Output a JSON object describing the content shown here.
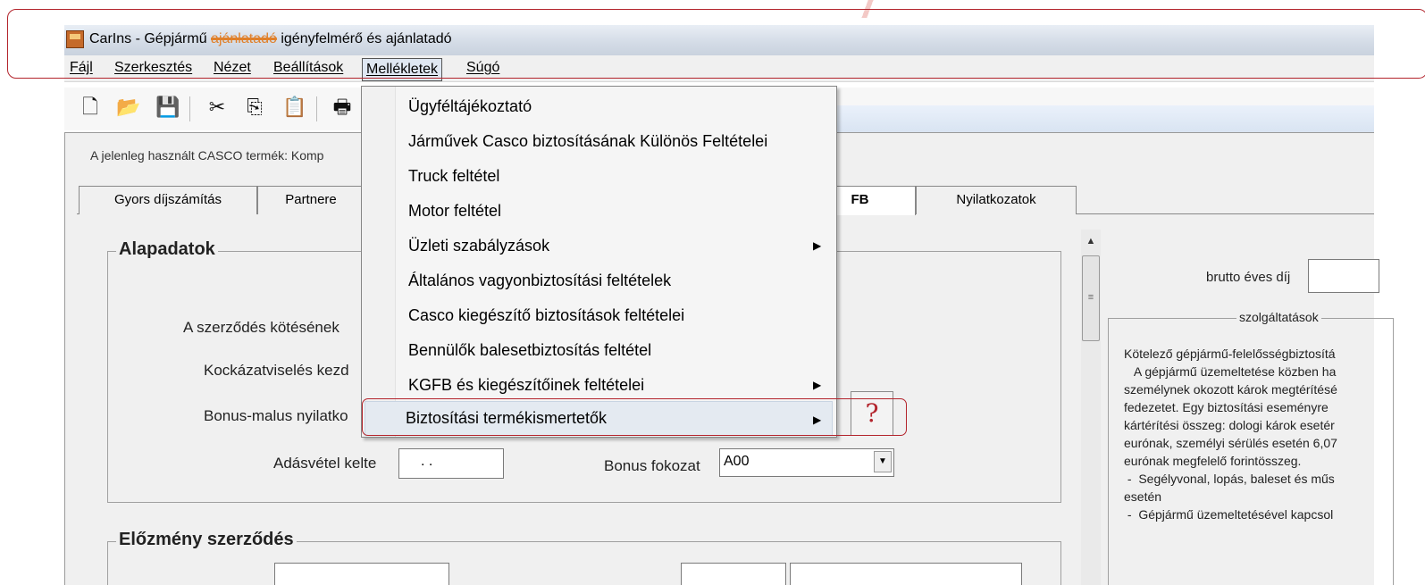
{
  "window": {
    "title_prefix": "CarIns - Gépjármű ",
    "title_struck": "ajánlatadó",
    "title_suffix": " igényfelmérő és ajánlatadó"
  },
  "menubar": {
    "items": [
      "Fájl",
      "Szerkesztés",
      "Nézet",
      "Beállítások",
      "Mellékletek",
      "Súgó"
    ],
    "active": "Mellékletek"
  },
  "toolbar": {
    "icons": [
      "new-document-icon",
      "open-folder-icon",
      "save-icon",
      "cut-icon",
      "copy-icon",
      "paste-icon",
      "print-icon"
    ],
    "glyphs": [
      "🗋",
      "📂",
      "💾",
      "✂",
      "⎘",
      "📋",
      "🖶"
    ]
  },
  "casco_text": "A jelenleg használt CASCO termék: Komp",
  "tabs": [
    {
      "label": "Gyors díjszámítás"
    },
    {
      "label": "Partnere"
    },
    {
      "label": "FB"
    },
    {
      "label": "Nyilatkozatok"
    }
  ],
  "alapadatok": {
    "title": "Alapadatok",
    "szerzodes_label": "A szerződés kötésének",
    "kockazat_label": "Kockázatviselés kezd",
    "bonus_label": "Bonus-malus nyilatko",
    "adasvetel_label": "Adásvétel kelte",
    "adasvetel_value": ". .",
    "bonus_fokozat_label": "Bonus fokozat",
    "bonus_fokozat_value": "A00"
  },
  "elozmeny": {
    "title": "Előzmény szerződés"
  },
  "right_panel": {
    "brutto_label": "brutto éves díj",
    "szolg_title": "szolgáltatások",
    "szolg_text": "Kötelező gépjármű-felelősségbiztosítá\n   A gépjármű üzemeltetése közben ha\nszemélynek okozott károk megtérítésé\nfedezetet. Egy biztosítási eseményre \nkártérítési összeg: dologi károk esetér\neurónak, személyi sérülés esetén 6,07\neurónak megfelelő forintösszeg.\n -  Segélyvonal, lopás, baleset és műs\nesetén\n -  Gépjármű üzemeltetésével kapcsol"
  },
  "dropdown": {
    "items": [
      {
        "label": "Ügyféltájékoztató",
        "submenu": false
      },
      {
        "label": "Járművek Casco biztosításának Különös Feltételei",
        "submenu": false
      },
      {
        "label": "Truck feltétel",
        "submenu": false
      },
      {
        "label": "Motor feltétel",
        "submenu": false
      },
      {
        "label": "Üzleti szabályzások",
        "submenu": true
      },
      {
        "label": "Általános vagyonbiztosítási feltételek",
        "submenu": false
      },
      {
        "label": "Casco kiegészítő biztosítások feltételei",
        "submenu": false
      },
      {
        "label": "Bennülők balesetbiztosítás feltétel",
        "submenu": false
      },
      {
        "label": "KGFB és kiegészítőinek feltételei",
        "submenu": true
      },
      {
        "label": "Biztosítási termékismertetők",
        "submenu": true
      }
    ],
    "highlighted": "Biztosítási termékismertetők",
    "arrow_glyph": "▶"
  },
  "help_button": {
    "glyph": "?"
  },
  "colors": {
    "callout": "#b3242c",
    "strike": "#e0802a"
  }
}
